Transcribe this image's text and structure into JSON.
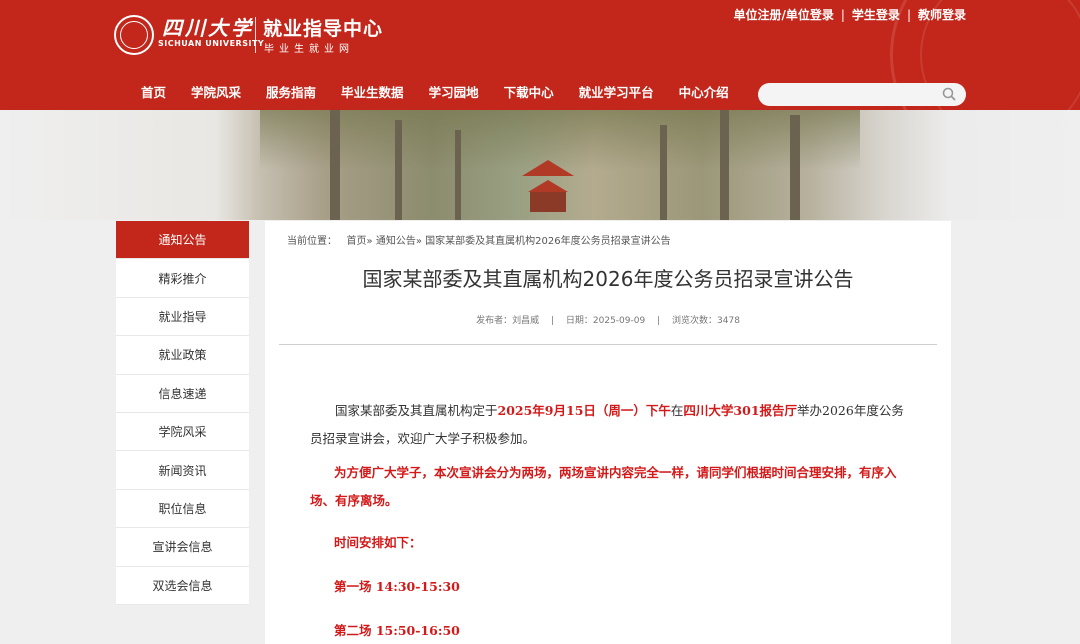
{
  "header": {
    "logo_cn": "四川大学",
    "logo_en": "SICHUAN UNIVERSITY",
    "site_name": "就业指导中心",
    "site_sub": "毕业生就业网",
    "top_links": [
      "单位注册/单位登录",
      "学生登录",
      "教师登录"
    ],
    "top_sep": "|"
  },
  "nav": [
    "首页",
    "学院风采",
    "服务指南",
    "毕业生数据",
    "学习园地",
    "下载中心",
    "就业学习平台",
    "中心介绍"
  ],
  "search": {
    "placeholder": "",
    "icon": "search-icon"
  },
  "sidebar": [
    "通知公告",
    "精彩推介",
    "就业指导",
    "就业政策",
    "信息速递",
    "学院风采",
    "新闻资讯",
    "职位信息",
    "宣讲会信息",
    "双选会信息"
  ],
  "breadcrumb": {
    "prefix": "当前位置：",
    "home": "首页",
    "sep": "»",
    "section": "通知公告",
    "current": "国家某部委及其直属机构2026年度公务员招录宣讲公告"
  },
  "article": {
    "title": "国家某部委及其直属机构2026年度公务员招录宣讲公告",
    "meta": {
      "author_label": "发布者：",
      "author": "刘昌威",
      "date_label": "日期：",
      "date": "2025-09-09",
      "views_label": "浏览次数：",
      "views": "3478",
      "sep": "|"
    },
    "p1_a": "国家某部委及其直属机构定于",
    "p1_b": "2025年9月15日（周一）下午",
    "p1_c": "在",
    "p1_d": "四川大学301报告厅",
    "p1_e": "举办2026年度公务员招录宣讲会，欢迎广大学子积极参加。",
    "p2": "为方便广大学子，本次宣讲会分为两场，两场宣讲内容完全一样，请同学们根据时间合理安排，有序入场、有序离场。",
    "p3": "时间安排如下：",
    "p4": "第一场  14:30-15:30",
    "p5": "第二场  15:50-16:50"
  },
  "colors": {
    "brand_red": "#c3261a",
    "highlight_red": "#d31a1a"
  }
}
